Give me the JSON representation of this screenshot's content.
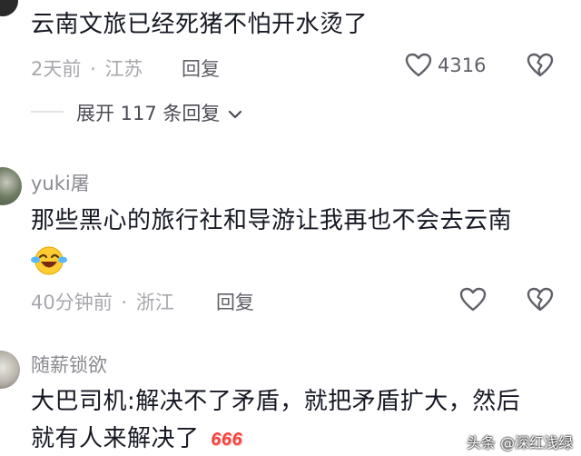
{
  "comments": [
    {
      "text": "云南文旅已经死猪不怕开水烫了",
      "time": "2天前",
      "location": "江苏",
      "reply_label": "回复",
      "likes": "4316"
    },
    {
      "username": "yuki屠",
      "text": "那些黑心的旅行社和导游让我再也不会去云南",
      "emoji": "crying-laughing-emoji",
      "time": "40分钟前",
      "location": "浙江",
      "reply_label": "回复"
    },
    {
      "username": "随薪锁欲",
      "text_line1": "大巴司机:解决不了矛盾，就把矛盾扩大，然后",
      "text_line2": "就有人来解决了",
      "emoji": "666-emoji"
    }
  ],
  "expand_replies": {
    "label": "展开 117 条回复"
  },
  "separator": "·",
  "watermark": {
    "text": "头条 @深红浅绿"
  },
  "colors": {
    "text": "#161823",
    "meta": "#a7a8ad",
    "accent_red": "#f2443f"
  }
}
